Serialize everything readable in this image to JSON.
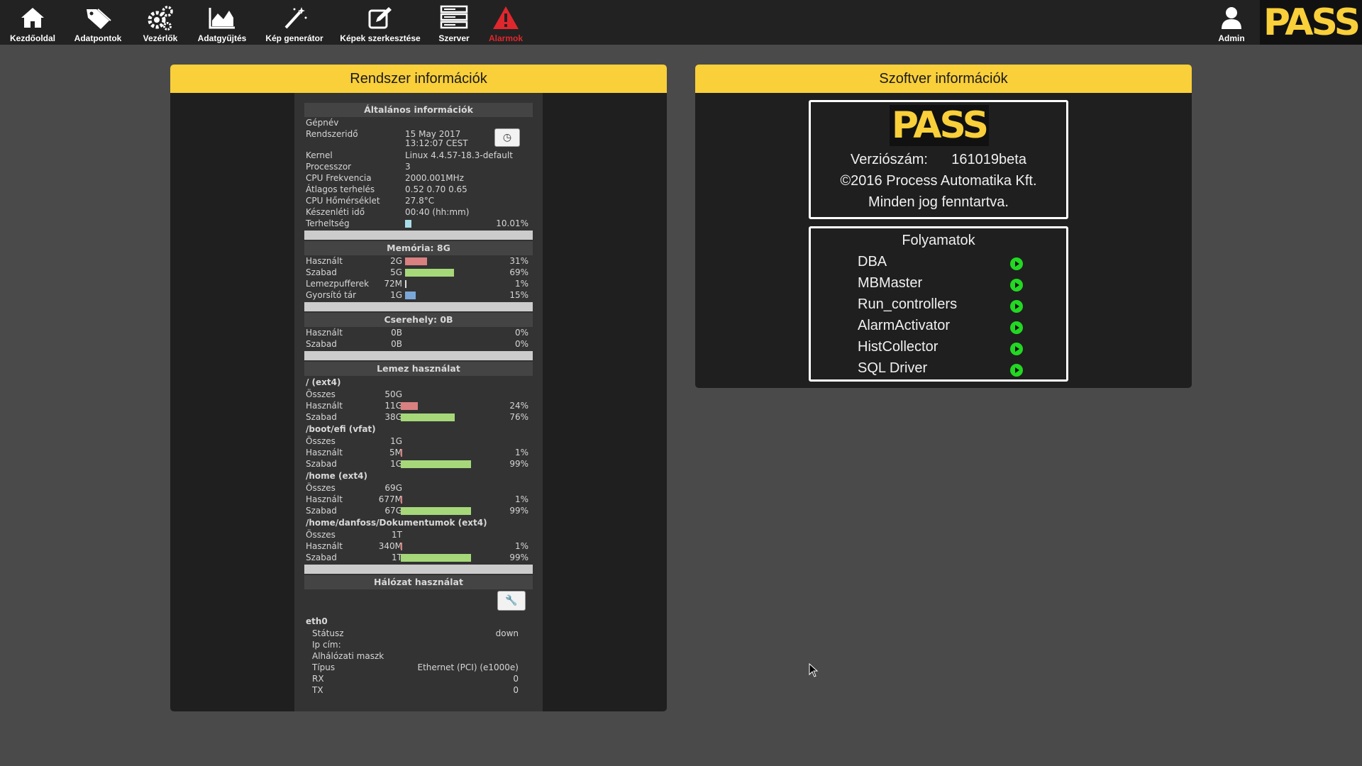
{
  "nav": {
    "items": [
      {
        "label": "Kezdőoldal",
        "icon": "home-icon"
      },
      {
        "label": "Adatpontok",
        "icon": "tag-icon"
      },
      {
        "label": "Vezérlők",
        "icon": "gears-icon"
      },
      {
        "label": "Adatgyűjtés",
        "icon": "area-chart-icon"
      },
      {
        "label": "Kép generátor",
        "icon": "magic-wand-icon"
      },
      {
        "label": "Képek szerkesztése",
        "icon": "edit-icon"
      },
      {
        "label": "Szerver",
        "icon": "server-icon"
      },
      {
        "label": "Alarmok",
        "icon": "warning-icon"
      }
    ],
    "admin_label": "Admin",
    "brand": "PASS",
    "colors": {
      "bar": "#222222",
      "alarm": "#e0272d",
      "brand": "#f9cf3a"
    }
  },
  "system": {
    "title": "Rendszer információk",
    "general": {
      "title": "Általános információk",
      "rows": [
        {
          "label": "Gépnév",
          "value": ""
        },
        {
          "label": "Rendszeridő",
          "value": "15 May 2017",
          "value2": "13:12:07 CEST"
        },
        {
          "label": "Kernel",
          "value": "Linux 4.4.57-18.3-default"
        },
        {
          "label": "Processzor",
          "value": "3"
        },
        {
          "label": "CPU Frekvencia",
          "value": "2000.001MHz"
        },
        {
          "label": "Átlagos terhelés",
          "value": "0.52 0.70 0.65"
        },
        {
          "label": "CPU Hőmérséklet",
          "value": "27.8°C"
        },
        {
          "label": "Készenléti idő",
          "value": "00:40 (hh:mm)"
        }
      ],
      "load": {
        "label": "Terheltség",
        "pct": "10.01%",
        "fraction": 0.1001
      }
    },
    "memory": {
      "title": "Memória: 8G",
      "rows": [
        {
          "label": "Használt",
          "amount": "2G",
          "pct": "31%",
          "fraction": 0.31,
          "color": "red"
        },
        {
          "label": "Szabad",
          "amount": "5G",
          "pct": "69%",
          "fraction": 0.69,
          "color": "green"
        },
        {
          "label": "Lemezpufferek",
          "amount": "72M",
          "pct": "1%",
          "fraction": 0.01,
          "color": "light"
        },
        {
          "label": "Gyorsító tár",
          "amount": "1G",
          "pct": "15%",
          "fraction": 0.15,
          "color": "blue"
        }
      ]
    },
    "swap": {
      "title": "Cserehely: 0B",
      "rows": [
        {
          "label": "Használt",
          "amount": "0B",
          "pct": "0%"
        },
        {
          "label": "Szabad",
          "amount": "0B",
          "pct": "0%"
        }
      ]
    },
    "disk": {
      "title": "Lemez használat",
      "mounts": [
        {
          "name": "/ (ext4)",
          "total_label": "Összes",
          "total": "50G",
          "used": {
            "label": "Használt",
            "amount": "11G",
            "pct": "24%",
            "fraction": 0.24
          },
          "free": {
            "label": "Szabad",
            "amount": "38G",
            "pct": "76%",
            "fraction": 0.76
          }
        },
        {
          "name": "/boot/efi (vfat)",
          "total_label": "Összes",
          "total": "1G",
          "used": {
            "label": "Használt",
            "amount": "5M",
            "pct": "1%",
            "fraction": 0.01
          },
          "free": {
            "label": "Szabad",
            "amount": "1G",
            "pct": "99%",
            "fraction": 0.99
          }
        },
        {
          "name": "/home (ext4)",
          "total_label": "Összes",
          "total": "69G",
          "used": {
            "label": "Használt",
            "amount": "677M",
            "pct": "1%",
            "fraction": 0.01
          },
          "free": {
            "label": "Szabad",
            "amount": "67G",
            "pct": "99%",
            "fraction": 0.99
          }
        },
        {
          "name": "/home/danfoss/Dokumentumok (ext4)",
          "total_label": "Összes",
          "total": "1T",
          "used": {
            "label": "Használt",
            "amount": "340M",
            "pct": "1%",
            "fraction": 0.01
          },
          "free": {
            "label": "Szabad",
            "amount": "1T",
            "pct": "99%",
            "fraction": 0.99
          }
        }
      ]
    },
    "network": {
      "title": "Hálózat használat",
      "iface": "eth0",
      "rows": [
        {
          "label": "Státusz",
          "value": "down"
        },
        {
          "label": "Ip cím:",
          "value": ""
        },
        {
          "label": "Alhálózati maszk",
          "value": ""
        },
        {
          "label": "Típus",
          "value": "Ethernet (PCI) (e1000e)"
        },
        {
          "label": "RX",
          "value": "0"
        },
        {
          "label": "TX",
          "value": "0"
        }
      ]
    }
  },
  "software": {
    "title": "Szoftver információk",
    "logo": "PASS",
    "version_label": "Verziószám:",
    "version": "161019beta",
    "copyright": "©2016 Process Automatika Kft.",
    "rights": "Minden jog fenntartva.",
    "processes_title": "Folyamatok",
    "processes": [
      {
        "name": "DBA",
        "status": "running"
      },
      {
        "name": "MBMaster",
        "status": "running"
      },
      {
        "name": "Run_controllers",
        "status": "running"
      },
      {
        "name": "AlarmActivator",
        "status": "running"
      },
      {
        "name": "HistCollector",
        "status": "running"
      },
      {
        "name": "SQL Driver",
        "status": "running"
      }
    ]
  }
}
